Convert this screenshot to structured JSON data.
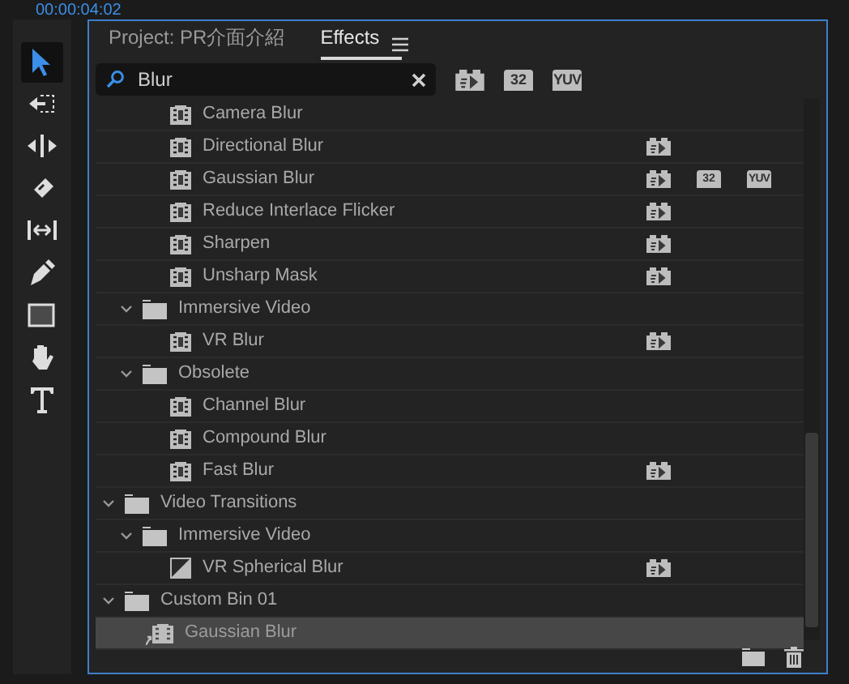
{
  "timecode": "00:00:04:02",
  "tools": [
    {
      "kind": "select",
      "selected": true
    },
    {
      "kind": "track-select",
      "selected": false
    },
    {
      "kind": "ripple",
      "selected": false
    },
    {
      "kind": "razor",
      "selected": false
    },
    {
      "kind": "slip",
      "selected": false
    },
    {
      "kind": "pen",
      "selected": false
    },
    {
      "kind": "rectangle",
      "selected": false
    },
    {
      "kind": "hand",
      "selected": false
    },
    {
      "kind": "type",
      "selected": false
    }
  ],
  "tabs": [
    {
      "label": "Project: PR介面介紹",
      "selected": false
    },
    {
      "label": "Effects",
      "selected": true
    }
  ],
  "search": {
    "value": "Blur"
  },
  "filters": [
    {
      "kind": "accelerated"
    },
    {
      "kind": "bits",
      "label": "32"
    },
    {
      "kind": "yuv",
      "label": "YUV"
    }
  ],
  "tree": [
    {
      "children": [
        {
          "children": [
            {
              "kind": "effect",
              "label": "Camera Blur",
              "selected": false
            },
            {
              "kind": "effect",
              "label": "Directional Blur",
              "selected": false,
              "badges": [
                {
                  "kind": "accelerated"
                }
              ]
            },
            {
              "kind": "effect",
              "label": "Gaussian Blur",
              "selected": false,
              "badges": [
                {
                  "kind": "accelerated"
                },
                {
                  "kind": "bits",
                  "label": "32"
                },
                {
                  "kind": "yuv",
                  "label": "YUV"
                }
              ]
            },
            {
              "kind": "effect",
              "label": "Reduce Interlace Flicker",
              "selected": false,
              "badges": [
                {
                  "kind": "accelerated"
                }
              ]
            },
            {
              "kind": "effect",
              "label": "Sharpen",
              "selected": false,
              "badges": [
                {
                  "kind": "accelerated"
                }
              ]
            },
            {
              "kind": "effect",
              "label": "Unsharp Mask",
              "selected": false,
              "badges": [
                {
                  "kind": "accelerated"
                }
              ]
            }
          ]
        },
        {
          "kind": "folder",
          "label": "Immersive Video",
          "expanded": true,
          "selected": false,
          "children": [
            {
              "kind": "effect",
              "label": "VR Blur",
              "selected": false,
              "badges": [
                {
                  "kind": "accelerated"
                }
              ]
            }
          ]
        },
        {
          "kind": "folder",
          "label": "Obsolete",
          "expanded": true,
          "selected": false,
          "children": [
            {
              "kind": "effect",
              "label": "Channel Blur",
              "selected": false
            },
            {
              "kind": "effect",
              "label": "Compound Blur",
              "selected": false
            },
            {
              "kind": "effect",
              "label": "Fast Blur",
              "selected": false,
              "badges": [
                {
                  "kind": "accelerated"
                }
              ]
            }
          ]
        }
      ]
    },
    {
      "kind": "folder",
      "label": "Video Transitions",
      "expanded": true,
      "selected": false,
      "children": [
        {
          "kind": "folder",
          "label": "Immersive Video",
          "expanded": true,
          "selected": false,
          "children": [
            {
              "kind": "transition",
              "label": "VR Spherical Blur",
              "selected": false,
              "badges": [
                {
                  "kind": "accelerated"
                }
              ]
            }
          ]
        }
      ]
    },
    {
      "kind": "folder",
      "label": "Custom Bin 01",
      "expanded": true,
      "selected": false,
      "children": [
        {
          "kind": "preset",
          "label": "Gaussian Blur",
          "selected": true
        }
      ]
    }
  ]
}
